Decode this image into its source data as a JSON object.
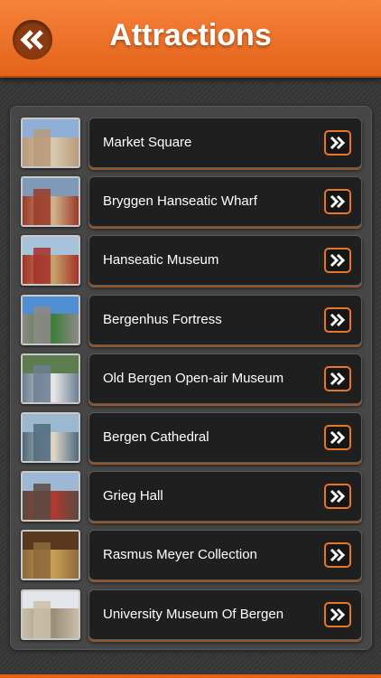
{
  "header": {
    "title": "Attractions",
    "back_icon": "double-chevron-left-icon"
  },
  "colors": {
    "accent": "#e9742a",
    "header": "#f07a2e"
  },
  "attractions": [
    {
      "label": "Market Square",
      "thumb_colors": [
        "#8fb0d6",
        "#b89a7a",
        "#d9c9b0"
      ]
    },
    {
      "label": "Bryggen Hanseatic Wharf",
      "thumb_colors": [
        "#7e9ab8",
        "#9b3b2a",
        "#d2b48c"
      ]
    },
    {
      "label": "Hanseatic Museum",
      "thumb_colors": [
        "#a8c4dc",
        "#a3312a",
        "#c9a26a"
      ]
    },
    {
      "label": "Bergenhus Fortress",
      "thumb_colors": [
        "#4f8ed0",
        "#8d8a85",
        "#3f7d3a"
      ]
    },
    {
      "label": "Old Bergen Open-air Museum",
      "thumb_colors": [
        "#5b7d4f",
        "#6b7f92",
        "#e8e8e8"
      ]
    },
    {
      "label": "Bergen Cathedral",
      "thumb_colors": [
        "#9cb8cf",
        "#4f6a7f",
        "#e0d7c8"
      ]
    },
    {
      "label": "Grieg Hall",
      "thumb_colors": [
        "#9db7d6",
        "#5a4a3f",
        "#b0392f"
      ]
    },
    {
      "label": "Rasmus Meyer Collection",
      "thumb_colors": [
        "#5a3a1e",
        "#8c6a3a",
        "#c9a055"
      ]
    },
    {
      "label": "University Museum Of Bergen",
      "thumb_colors": [
        "#e2e6ea",
        "#c9bfa8",
        "#9a8e78"
      ]
    }
  ]
}
